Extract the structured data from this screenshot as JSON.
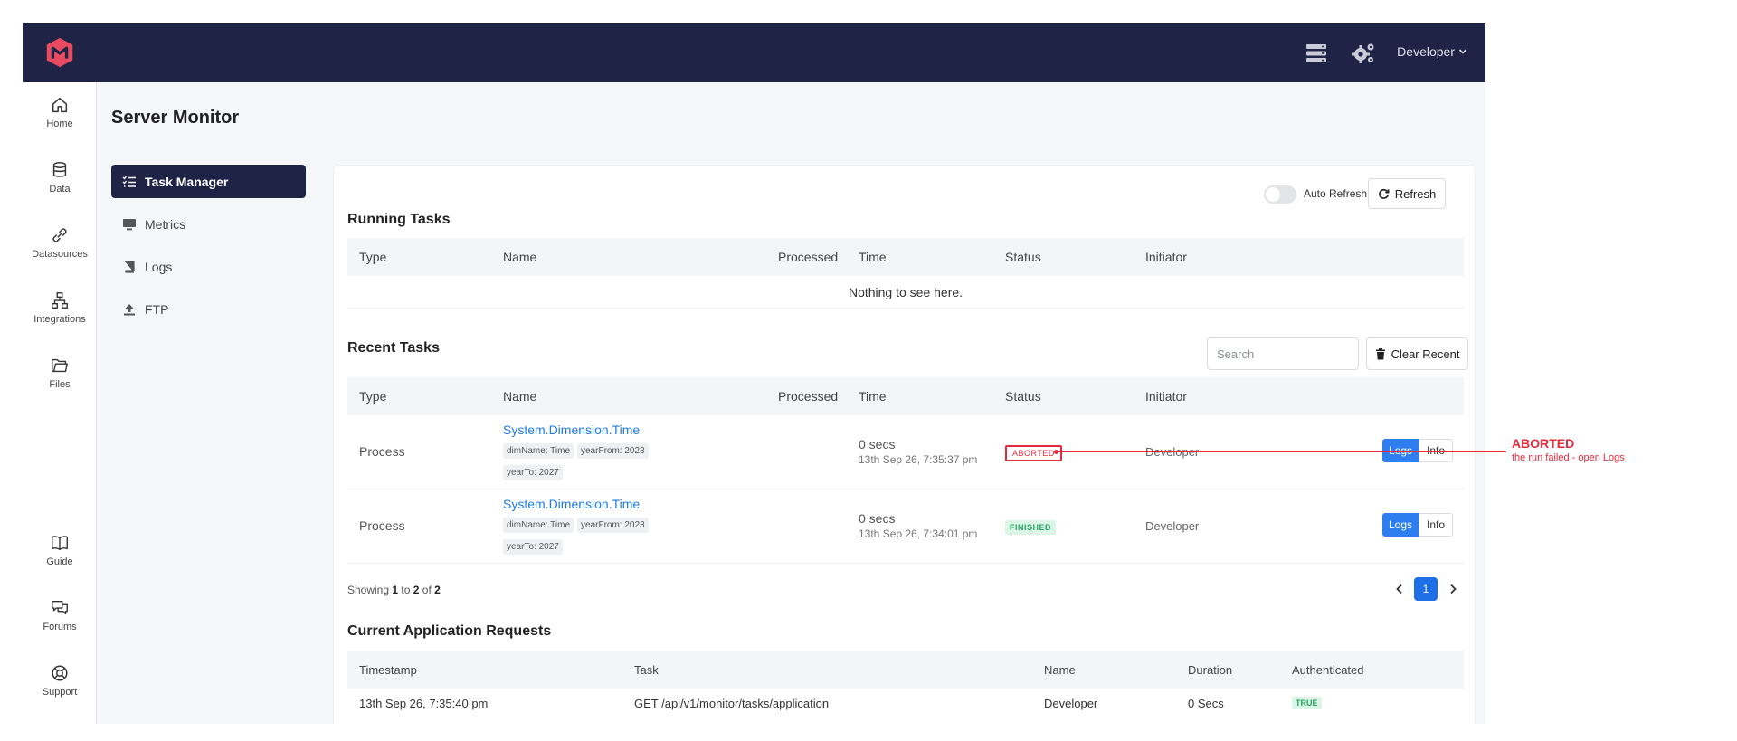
{
  "topbar": {
    "user_label": "Developer",
    "icons": [
      "logo-icon",
      "server-icon",
      "settings-gears-icon",
      "chevron-down-icon"
    ]
  },
  "rail": {
    "items": [
      {
        "label": "Home",
        "icon": "home-icon"
      },
      {
        "label": "Data",
        "icon": "database-icon"
      },
      {
        "label": "Datasources",
        "icon": "link-icon"
      },
      {
        "label": "Integrations",
        "icon": "sitemap-icon"
      },
      {
        "label": "Files",
        "icon": "folder-icon"
      },
      {
        "label": "Guide",
        "icon": "book-icon"
      },
      {
        "label": "Forums",
        "icon": "chat-icon"
      },
      {
        "label": "Support",
        "icon": "lifebuoy-icon"
      }
    ]
  },
  "page": {
    "title": "Server Monitor"
  },
  "subnav": {
    "items": [
      {
        "label": "Task Manager",
        "icon": "task-list-icon",
        "active": true
      },
      {
        "label": "Metrics",
        "icon": "monitor-icon",
        "active": false
      },
      {
        "label": "Logs",
        "icon": "log-book-icon",
        "active": false
      },
      {
        "label": "FTP",
        "icon": "upload-icon",
        "active": false
      }
    ]
  },
  "controls": {
    "auto_refresh_label": "Auto Refresh",
    "auto_refresh_on": false,
    "refresh_label": "Refresh",
    "search_placeholder": "Search",
    "clear_recent_label": "Clear Recent"
  },
  "running": {
    "title": "Running Tasks",
    "columns": [
      "Type",
      "Name",
      "Processed",
      "Time",
      "Status",
      "Initiator"
    ],
    "empty_text": "Nothing to see here."
  },
  "recent": {
    "title": "Recent Tasks",
    "columns": [
      "Type",
      "Name",
      "Processed",
      "Time",
      "Status",
      "Initiator"
    ],
    "rows": [
      {
        "type": "Process",
        "name": "System.Dimension.Time",
        "tags": [
          "dimName: Time",
          "yearFrom: 2023",
          "yearTo: 2027"
        ],
        "time": "0 secs",
        "time_sub": "13th Sep 26, 7:35:37 pm",
        "status": "ABORTED",
        "initiator": "Developer",
        "logs_label": "Logs",
        "info_label": "Info"
      },
      {
        "type": "Process",
        "name": "System.Dimension.Time",
        "tags": [
          "dimName: Time",
          "yearFrom: 2023",
          "yearTo: 2027"
        ],
        "time": "0 secs",
        "time_sub": "13th Sep 26, 7:34:01 pm",
        "status": "FINISHED",
        "initiator": "Developer",
        "logs_label": "Logs",
        "info_label": "Info"
      }
    ],
    "showing_prefix": "Showing",
    "showing_from": "1",
    "showing_to_word": "to",
    "showing_to": "2",
    "showing_of_word": "of",
    "showing_total": "2",
    "current_page": "1"
  },
  "requests": {
    "title": "Current Application Requests",
    "columns": [
      "Timestamp",
      "Task",
      "Name",
      "Duration",
      "Authenticated"
    ],
    "rows": [
      {
        "timestamp": "13th Sep 26, 7:35:40 pm",
        "task": "GET /api/v1/monitor/tasks/application",
        "name": "Developer",
        "duration": "0 Secs",
        "authenticated": "TRUE"
      }
    ]
  },
  "annotation": {
    "title": "ABORTED",
    "subtitle": "the run failed - open Logs",
    "color": "#e22b3c"
  },
  "colors": {
    "topbar": "#1f2447",
    "accent_blue": "#2f7ef0",
    "link_blue": "#1e7be0",
    "aborted_red": "#e22b3c",
    "finished_green": "#28a464"
  }
}
